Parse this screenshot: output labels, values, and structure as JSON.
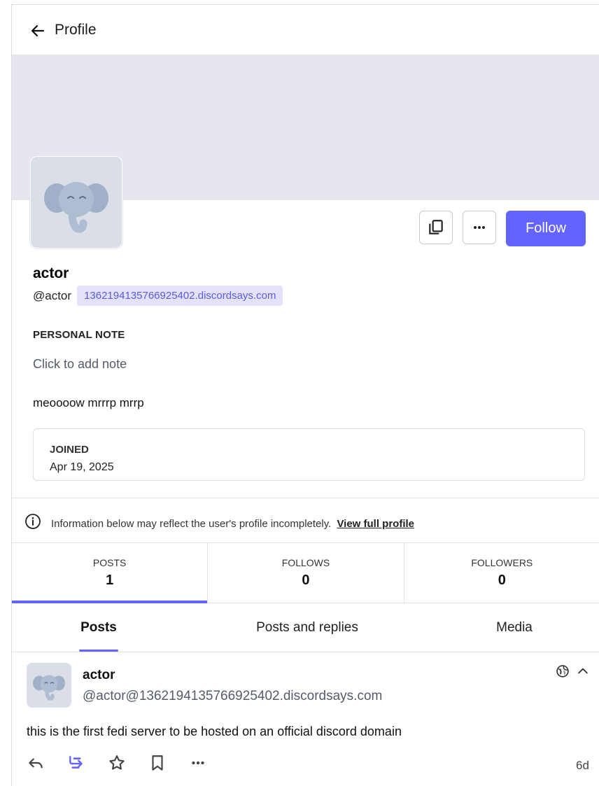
{
  "header": {
    "title": "Profile"
  },
  "profile": {
    "display_name": "actor",
    "handle": "@actor",
    "domain": "1362194135766925402.discordsays.com",
    "follow_label": "Follow",
    "note_label": "PERSONAL NOTE",
    "note_placeholder": "Click to add note",
    "bio": "meoooow mrrrp mrrp",
    "joined_label": "JOINED",
    "joined_value": "Apr 19, 2025"
  },
  "info": {
    "text": "Information below may reflect the user's profile incompletely.",
    "link": "View full profile"
  },
  "stats": [
    {
      "label": "POSTS",
      "value": "1"
    },
    {
      "label": "FOLLOWS",
      "value": "0"
    },
    {
      "label": "FOLLOWERS",
      "value": "0"
    }
  ],
  "tabs": [
    {
      "label": "Posts"
    },
    {
      "label": "Posts and replies"
    },
    {
      "label": "Media"
    }
  ],
  "post": {
    "name": "actor",
    "handle": "@actor@1362194135766925402.discordsays.com",
    "content": "this is the first fedi server to be hosted on an official discord domain",
    "time": "6d"
  },
  "icons": {
    "back": "arrow-left-icon",
    "copy": "copy-icon",
    "more": "more-horizontal-icon",
    "info": "info-icon",
    "globe": "globe-icon",
    "collapse": "chevron-up-icon",
    "reply": "reply-icon",
    "boost": "boost-icon",
    "favourite": "star-icon",
    "bookmark": "bookmark-icon"
  },
  "colors": {
    "accent": "#6364ff",
    "banner": "#e7e6ef",
    "domain_badge_bg": "#e4e2fb",
    "domain_badge_text": "#5b5bde"
  }
}
